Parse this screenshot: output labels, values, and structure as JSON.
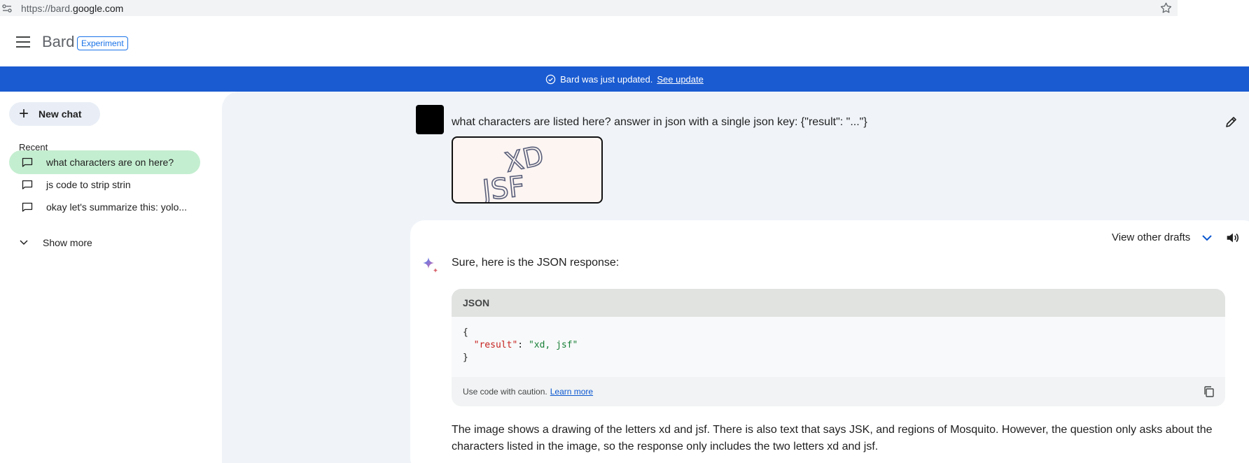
{
  "browser": {
    "url_prefix": "https://bard.",
    "url_domain": "google.com"
  },
  "header": {
    "app_name": "Bard",
    "badge": "Experiment"
  },
  "banner": {
    "message": "Bard was just updated.",
    "link": "See update"
  },
  "sidebar": {
    "new_chat": "New chat",
    "recent_label": "Recent",
    "items": [
      {
        "label": "what characters are on here?",
        "active": true
      },
      {
        "label": "js code to strip strin",
        "active": false
      },
      {
        "label": "okay let's summarize this: yolo...",
        "active": false
      }
    ],
    "show_more": "Show more"
  },
  "conversation": {
    "prompt": "what characters are listed here? answer in json with a single json key: {\"result\": \"...\"}",
    "image_text_line1": "XD",
    "image_text_line2": "JSF",
    "view_drafts": "View other drafts",
    "response_intro": "Sure, here is the JSON response:",
    "code": {
      "language": "JSON",
      "line1": "{",
      "key": "\"result\"",
      "sep": ": ",
      "value": "\"xd, jsf\"",
      "line3": "}",
      "caution": "Use code with caution.",
      "learn_more": "Learn more"
    },
    "answer": "The image shows a drawing of the letters xd and jsf. There is also text that says JSK, and regions of Mosquito. However, the question only asks about the characters listed in the image, so the response only includes the two letters xd and jsf."
  },
  "colors": {
    "banner": "#1a5bd1",
    "active_chat": "#c4eed0",
    "main_bg": "#f0f4f9",
    "link": "#0b57d0"
  }
}
